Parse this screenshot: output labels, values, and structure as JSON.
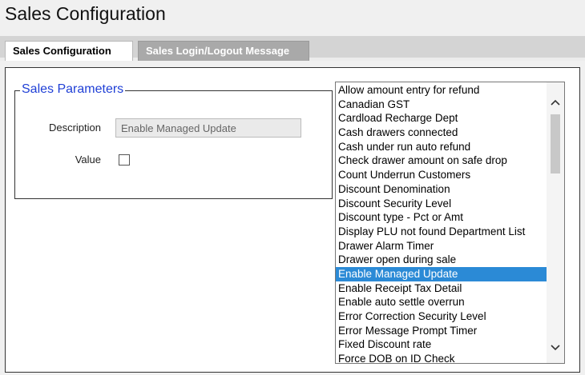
{
  "page": {
    "title": "Sales Configuration"
  },
  "tabs": [
    {
      "label": "Sales Configuration",
      "active": true
    },
    {
      "label": "Sales Login/Logout Message",
      "active": false
    }
  ],
  "sales_parameters": {
    "legend": "Sales Parameters",
    "description_label": "Description",
    "description_value": "Enable Managed Update",
    "value_label": "Value",
    "value_checked": false
  },
  "parameter_list": {
    "items": [
      "Allow amount entry for refund",
      "Canadian GST",
      "Cardload Recharge Dept",
      "Cash drawers connected",
      "Cash under run auto refund",
      "Check drawer amount on safe drop",
      "Count Underrun Customers",
      "Discount Denomination",
      "Discount Security Level",
      "Discount type - Pct or Amt",
      "Display PLU not found Department List",
      "Drawer Alarm Timer",
      "Drawer open during sale",
      "Enable Managed Update",
      "Enable Receipt Tax Detail",
      "Enable auto settle overrun",
      "Error Correction Security Level",
      "Error Message Prompt Timer",
      "Fixed Discount rate",
      "Force DOB on ID Check"
    ],
    "selected_index": 13,
    "selected_color": "#2b8ad6"
  },
  "icons": {
    "scroll_up": "chevron-up-icon",
    "scroll_down": "chevron-down-icon"
  }
}
